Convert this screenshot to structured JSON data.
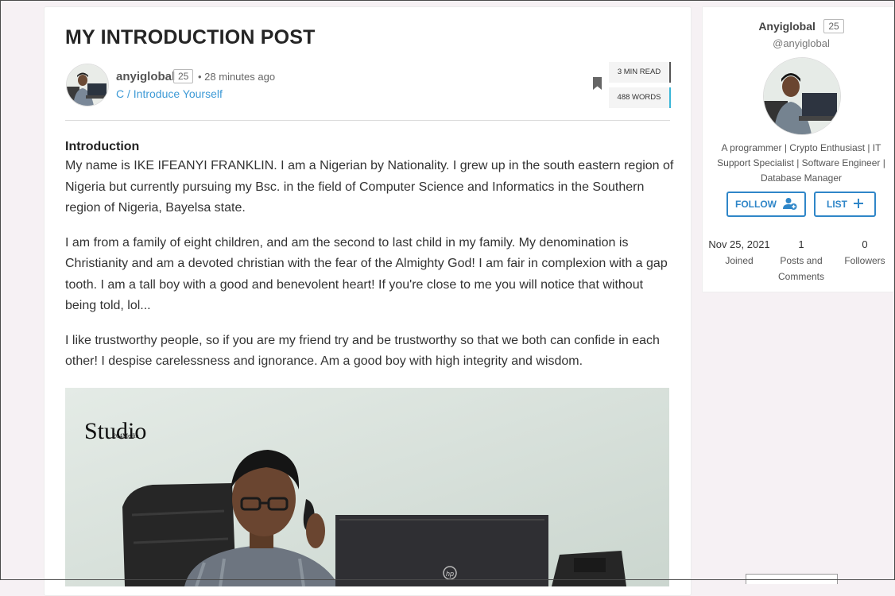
{
  "post": {
    "title": "MY INTRODUCTION POST",
    "author": "anyiglobal",
    "author_score": "25",
    "time": "• 28 minutes ago",
    "community": "C / Introduce Yourself",
    "read_time": "3 MIN READ",
    "word_count": "488 WORDS",
    "heading": "Introduction",
    "paragraphs": [
      "My name is IKE IFEANYI FRANKLIN. I am a Nigerian by Nationality. I grew up in the south eastern region of Nigeria but currently pursuing my Bsc. in the field of Computer Science and Informatics in the Southern region of Nigeria, Bayelsa state.",
      "I am from a family of eight children, and am the second to last child in my family. My denomination is Christianity and am a devoted christian with the fear of the Almighty God! I am fair in complexion with a gap tooth. I am a tall boy with a good and benevolent heart! If you're close to me you will notice that without being told, lol...",
      "I like trustworthy people, so if you are my friend try and be trustworthy so that we both can confide in each other! I despise carelessness and ignorance. Am a good boy with high integrity and wisdom."
    ],
    "image_watermark": "Studio",
    "image_watermark_sub": "264Media",
    "laptop_logo": "hp"
  },
  "profile": {
    "name": "Anyiglobal",
    "score": "25",
    "handle": "@anyiglobal",
    "bio": "A programmer | Crypto Enthusiast | IT Support Specialist | Software Engineer | Database Manager",
    "follow_label": "FOLLOW",
    "list_label": "LIST",
    "stats": {
      "joined_value": "Nov 25, 2021",
      "joined_label": "Joined",
      "posts_value": "1",
      "posts_label": "Posts and Comments",
      "followers_value": "0",
      "followers_label": "Followers"
    }
  },
  "colors": {
    "accent": "#2f86c8",
    "link": "#3e9ad6",
    "word_count_bar": "#3bb6d8",
    "page_background": "#f6f1f4"
  },
  "icons": {
    "bookmark": "bookmark-icon",
    "follow": "add-user-icon",
    "list": "plus-icon"
  }
}
